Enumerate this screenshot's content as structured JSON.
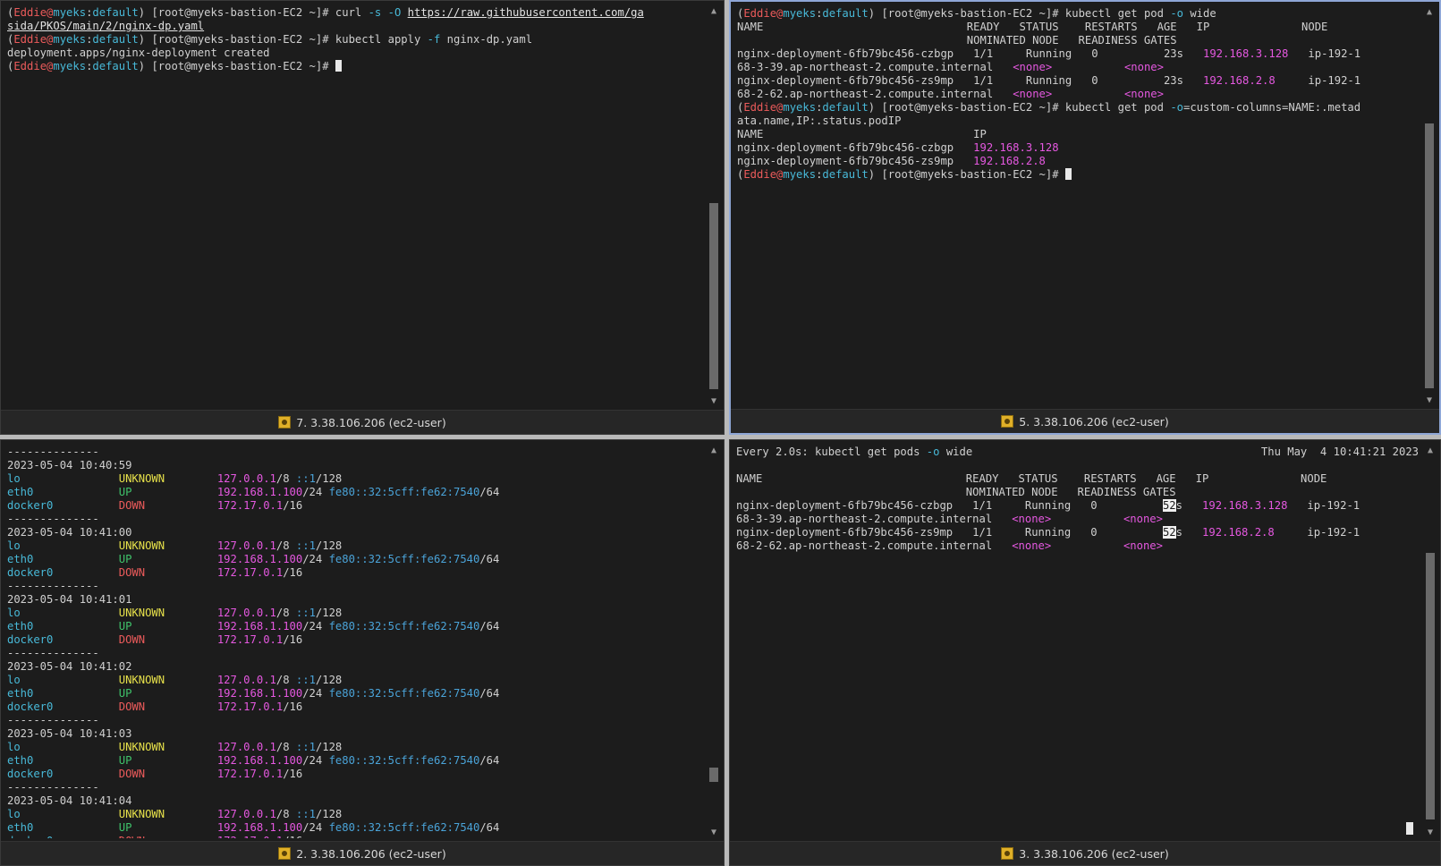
{
  "colors": {
    "pane_bg": "#1c1c1c",
    "prompt_user": "#ec5b5b",
    "prompt_context": "#48b9d8",
    "ip_magenta": "#e558e0",
    "state_unknown": "#e6e04a",
    "state_up": "#3fc26a",
    "state_down": "#ec5b5b",
    "ipv6": "#4aa3d8",
    "active_border": "#8ea6d6"
  },
  "prompt": {
    "open": "(",
    "user": "Eddie",
    "at": "@",
    "host": "myeks",
    "colon": ":",
    "ctx": "default",
    "rest": ") [root@myeks-bastion-EC2 ~]# "
  },
  "panes": {
    "top_left": {
      "status_label": "7. 3.38.106.206 (ec2-user)",
      "cmd1": {
        "a": "curl ",
        "flag1": "-s",
        "b": " ",
        "flag2": "-O",
        "c": " ",
        "url1": "https://raw.githubusercontent.com/ga"
      },
      "url1_cont": "sida/PKOS/main/2/nginx-dp.yaml",
      "cmd2": {
        "a": "kubectl apply ",
        "flag": "-f",
        "b": " nginx-dp.yaml"
      },
      "out2": "deployment.apps/nginx-deployment created"
    },
    "top_right": {
      "status_label": "5. 3.38.106.206 (ec2-user)",
      "cmd1": {
        "a": "kubectl get pod ",
        "flag": "-o",
        "b": " wide"
      },
      "wide_header1": "NAME                               READY   STATUS    RESTARTS   AGE   IP              NODE",
      "wide_header2": "                                   NOMINATED NODE   READINESS GATES",
      "rows": [
        {
          "name": "nginx-deployment-6fb79bc456-czbgp",
          "ready": "1/1",
          "status": "Running",
          "restarts": "0",
          "age": "23s",
          "ip": "192.168.3.128",
          "node_head": "ip-192-1",
          "node_tail": "68-3-39.ap-northeast-2.compute.internal",
          "nominated": "<none>",
          "readiness": "<none>"
        },
        {
          "name": "nginx-deployment-6fb79bc456-zs9mp",
          "ready": "1/1",
          "status": "Running",
          "restarts": "0",
          "age": "23s",
          "ip": "192.168.2.8",
          "node_head": "ip-192-1",
          "node_tail": "68-2-62.ap-northeast-2.compute.internal",
          "nominated": "<none>",
          "readiness": "<none>"
        }
      ],
      "cmd2": {
        "a": "kubectl get pod ",
        "flag": "-o",
        "b": "=custom-columns=NAME:.metad"
      },
      "cmd2_cont": "ata.name,IP:.status.podIP",
      "custom_header": "NAME                                IP",
      "custom_rows": [
        {
          "name": "nginx-deployment-6fb79bc456-czbgp",
          "ip": "192.168.3.128"
        },
        {
          "name": "nginx-deployment-6fb79bc456-zs9mp",
          "ip": "192.168.2.8"
        }
      ]
    },
    "bottom_left": {
      "status_label": "2. 3.38.106.206 (ec2-user)",
      "separator": "--------------",
      "blocks": [
        {
          "ts": "2023-05-04 10:40:59"
        },
        {
          "ts": "2023-05-04 10:41:00"
        },
        {
          "ts": "2023-05-04 10:41:01"
        },
        {
          "ts": "2023-05-04 10:41:02"
        },
        {
          "ts": "2023-05-04 10:41:03"
        },
        {
          "ts": "2023-05-04 10:41:04"
        }
      ],
      "iface_lo": {
        "name": "lo",
        "state": "UNKNOWN",
        "ip": "127.0.0.1",
        "mask": "/8",
        "ip6": "::1",
        "mask6": "/128"
      },
      "iface_eth0": {
        "name": "eth0",
        "state": "UP",
        "ip": "192.168.1.100",
        "mask": "/24",
        "ip6": "fe80::32:5cff:fe62:7540",
        "mask6": "/64"
      },
      "iface_docker0": {
        "name": "docker0",
        "state": "DOWN",
        "ip": "172.17.0.1",
        "mask": "/16"
      }
    },
    "bottom_right": {
      "status_label": "3. 3.38.106.206 (ec2-user)",
      "watch": {
        "a": "Every 2.0s: kubectl get pods ",
        "flag": "-o",
        "b": " wide",
        "clock": "Thu May  4 10:41:21 2023"
      },
      "age_hl": "52",
      "age_unit": "s"
    }
  }
}
